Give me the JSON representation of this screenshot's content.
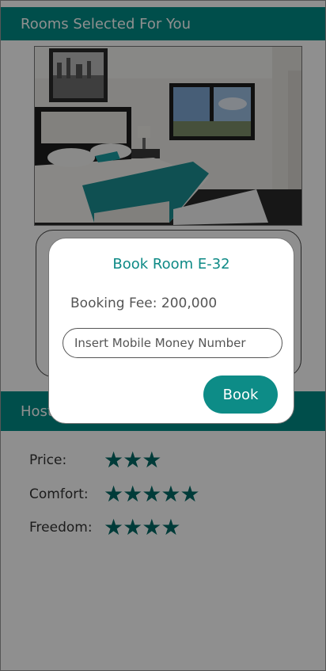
{
  "header": {
    "title": "Rooms Selected For You"
  },
  "host_section": {
    "title": "Host"
  },
  "ratings": [
    {
      "label": "Price:",
      "stars": 3
    },
    {
      "label": "Comfort:",
      "stars": 5
    },
    {
      "label": "Freedom:",
      "stars": 4
    }
  ],
  "dialog": {
    "title": "Book Room E-32",
    "fee": "Booking Fee: 200,000",
    "input_placeholder": "Insert Mobile Money Number",
    "input_value": "",
    "book_label": "Book"
  },
  "colors": {
    "accent": "#018c87",
    "star": "#016a66",
    "dialog_title": "#0e8a86"
  },
  "icons": {
    "rating": "star-icon",
    "room_photo": "bedroom-photo"
  }
}
